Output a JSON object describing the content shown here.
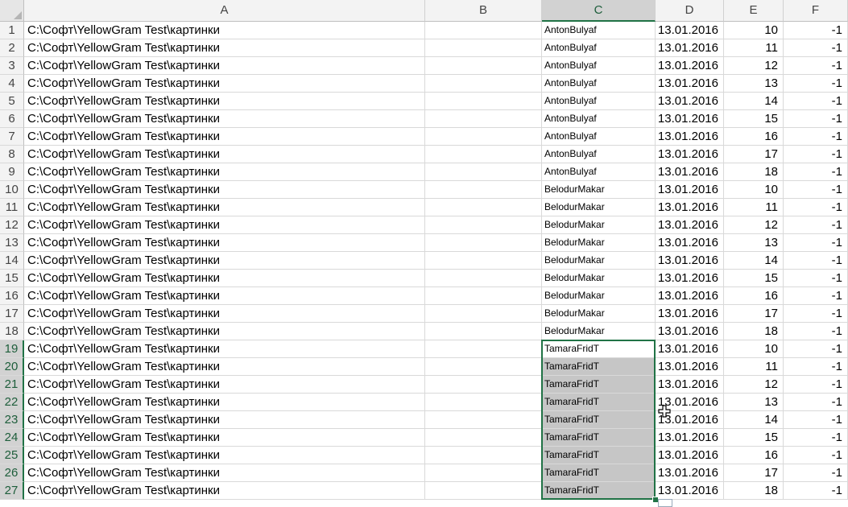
{
  "columns": [
    {
      "label": "A",
      "width": 498
    },
    {
      "label": "B",
      "width": 145
    },
    {
      "label": "C",
      "width": 141
    },
    {
      "label": "D",
      "width": 85
    },
    {
      "label": "E",
      "width": 74
    },
    {
      "label": "F",
      "width": 80
    }
  ],
  "rows": [
    {
      "n": "1",
      "a": "C:\\Софт\\YellowGram Test\\картинки",
      "c": "AntonBulyaf",
      "d": "13.01.2016",
      "e": "10",
      "f": "-1"
    },
    {
      "n": "2",
      "a": "C:\\Софт\\YellowGram Test\\картинки",
      "c": "AntonBulyaf",
      "d": "13.01.2016",
      "e": "11",
      "f": "-1"
    },
    {
      "n": "3",
      "a": "C:\\Софт\\YellowGram Test\\картинки",
      "c": "AntonBulyaf",
      "d": "13.01.2016",
      "e": "12",
      "f": "-1"
    },
    {
      "n": "4",
      "a": "C:\\Софт\\YellowGram Test\\картинки",
      "c": "AntonBulyaf",
      "d": "13.01.2016",
      "e": "13",
      "f": "-1"
    },
    {
      "n": "5",
      "a": "C:\\Софт\\YellowGram Test\\картинки",
      "c": "AntonBulyaf",
      "d": "13.01.2016",
      "e": "14",
      "f": "-1"
    },
    {
      "n": "6",
      "a": "C:\\Софт\\YellowGram Test\\картинки",
      "c": "AntonBulyaf",
      "d": "13.01.2016",
      "e": "15",
      "f": "-1"
    },
    {
      "n": "7",
      "a": "C:\\Софт\\YellowGram Test\\картинки",
      "c": "AntonBulyaf",
      "d": "13.01.2016",
      "e": "16",
      "f": "-1"
    },
    {
      "n": "8",
      "a": "C:\\Софт\\YellowGram Test\\картинки",
      "c": "AntonBulyaf",
      "d": "13.01.2016",
      "e": "17",
      "f": "-1"
    },
    {
      "n": "9",
      "a": "C:\\Софт\\YellowGram Test\\картинки",
      "c": "AntonBulyaf",
      "d": "13.01.2016",
      "e": "18",
      "f": "-1"
    },
    {
      "n": "10",
      "a": "C:\\Софт\\YellowGram Test\\картинки",
      "c": "BelodurMakar",
      "d": "13.01.2016",
      "e": "10",
      "f": "-1"
    },
    {
      "n": "11",
      "a": "C:\\Софт\\YellowGram Test\\картинки",
      "c": "BelodurMakar",
      "d": "13.01.2016",
      "e": "11",
      "f": "-1"
    },
    {
      "n": "12",
      "a": "C:\\Софт\\YellowGram Test\\картинки",
      "c": "BelodurMakar",
      "d": "13.01.2016",
      "e": "12",
      "f": "-1"
    },
    {
      "n": "13",
      "a": "C:\\Софт\\YellowGram Test\\картинки",
      "c": "BelodurMakar",
      "d": "13.01.2016",
      "e": "13",
      "f": "-1"
    },
    {
      "n": "14",
      "a": "C:\\Софт\\YellowGram Test\\картинки",
      "c": "BelodurMakar",
      "d": "13.01.2016",
      "e": "14",
      "f": "-1"
    },
    {
      "n": "15",
      "a": "C:\\Софт\\YellowGram Test\\картинки",
      "c": "BelodurMakar",
      "d": "13.01.2016",
      "e": "15",
      "f": "-1"
    },
    {
      "n": "16",
      "a": "C:\\Софт\\YellowGram Test\\картинки",
      "c": "BelodurMakar",
      "d": "13.01.2016",
      "e": "16",
      "f": "-1"
    },
    {
      "n": "17",
      "a": "C:\\Софт\\YellowGram Test\\картинки",
      "c": "BelodurMakar",
      "d": "13.01.2016",
      "e": "17",
      "f": "-1"
    },
    {
      "n": "18",
      "a": "C:\\Софт\\YellowGram Test\\картинки",
      "c": "BelodurMakar",
      "d": "13.01.2016",
      "e": "18",
      "f": "-1"
    },
    {
      "n": "19",
      "a": "C:\\Софт\\YellowGram Test\\картинки",
      "c": "TamaraFridT",
      "d": "13.01.2016",
      "e": "10",
      "f": "-1"
    },
    {
      "n": "20",
      "a": "C:\\Софт\\YellowGram Test\\картинки",
      "c": "TamaraFridT",
      "d": "13.01.2016",
      "e": "11",
      "f": "-1"
    },
    {
      "n": "21",
      "a": "C:\\Софт\\YellowGram Test\\картинки",
      "c": "TamaraFridT",
      "d": "13.01.2016",
      "e": "12",
      "f": "-1"
    },
    {
      "n": "22",
      "a": "C:\\Софт\\YellowGram Test\\картинки",
      "c": "TamaraFridT",
      "d": "13.01.2016",
      "e": "13",
      "f": "-1"
    },
    {
      "n": "23",
      "a": "C:\\Софт\\YellowGram Test\\картинки",
      "c": "TamaraFridT",
      "d": "13.01.2016",
      "e": "14",
      "f": "-1"
    },
    {
      "n": "24",
      "a": "C:\\Софт\\YellowGram Test\\картинки",
      "c": "TamaraFridT",
      "d": "13.01.2016",
      "e": "15",
      "f": "-1"
    },
    {
      "n": "25",
      "a": "C:\\Софт\\YellowGram Test\\картинки",
      "c": "TamaraFridT",
      "d": "13.01.2016",
      "e": "16",
      "f": "-1"
    },
    {
      "n": "26",
      "a": "C:\\Софт\\YellowGram Test\\картинки",
      "c": "TamaraFridT",
      "d": "13.01.2016",
      "e": "17",
      "f": "-1"
    },
    {
      "n": "27",
      "a": "C:\\Софт\\YellowGram Test\\картинки",
      "c": "TamaraFridT",
      "d": "13.01.2016",
      "e": "18",
      "f": "-1"
    }
  ],
  "selection": {
    "column": "C",
    "first_row": 19,
    "last_row": 27
  },
  "colors": {
    "accent": "#217346",
    "selection_fill": "#c6c6c6"
  },
  "icons": {
    "cursor": "move-cross-icon",
    "quick_analysis": "quick-analysis-icon"
  }
}
